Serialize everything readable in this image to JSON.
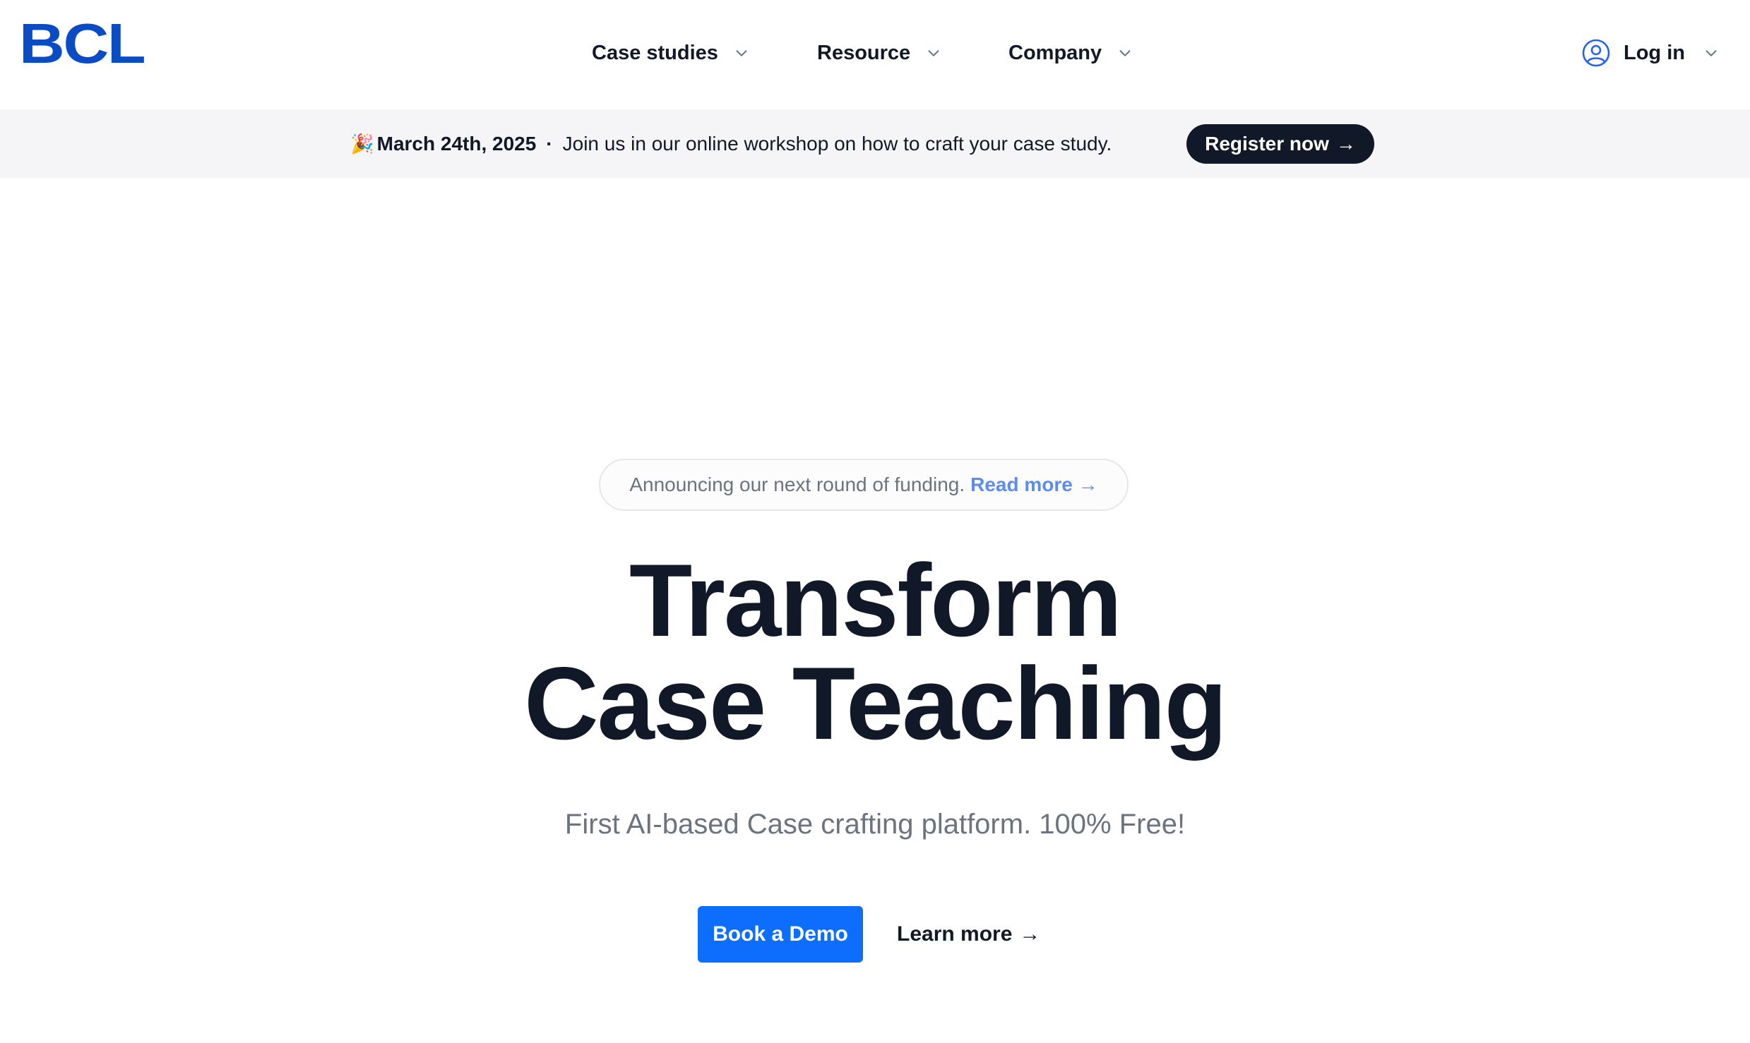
{
  "brand": {
    "logo_text": "BCL",
    "color": "#0b4cc4"
  },
  "nav": {
    "items": [
      {
        "label": "Case studies",
        "icon": "chevron-down-icon"
      },
      {
        "label": "Resource",
        "icon": "chevron-down-icon"
      },
      {
        "label": "Company",
        "icon": "chevron-down-icon"
      }
    ],
    "login": {
      "label": "Log in",
      "icon": "user-circle-icon"
    }
  },
  "announcement_bar": {
    "emoji": "🎉",
    "date": "March 24th, 2025",
    "separator": "·",
    "message": "Join us in our online workshop on how to craft your case study.",
    "button_label": "Register now",
    "button_arrow": "→"
  },
  "hero": {
    "pill_text": "Announcing our next round of funding.",
    "pill_link": "Read more",
    "pill_arrow": "→",
    "title_line1": "Transform",
    "title_line2": "Case Teaching",
    "subtitle": "First AI-based Case crafting platform. 100% Free!",
    "primary_cta": "Book a Demo",
    "secondary_cta": "Learn more",
    "secondary_arrow": "→"
  },
  "colors": {
    "accent": "#0d6efd",
    "dark": "#111827",
    "muted": "#6b7280",
    "link": "#5b8def",
    "bar_bg": "#f5f5f7"
  }
}
